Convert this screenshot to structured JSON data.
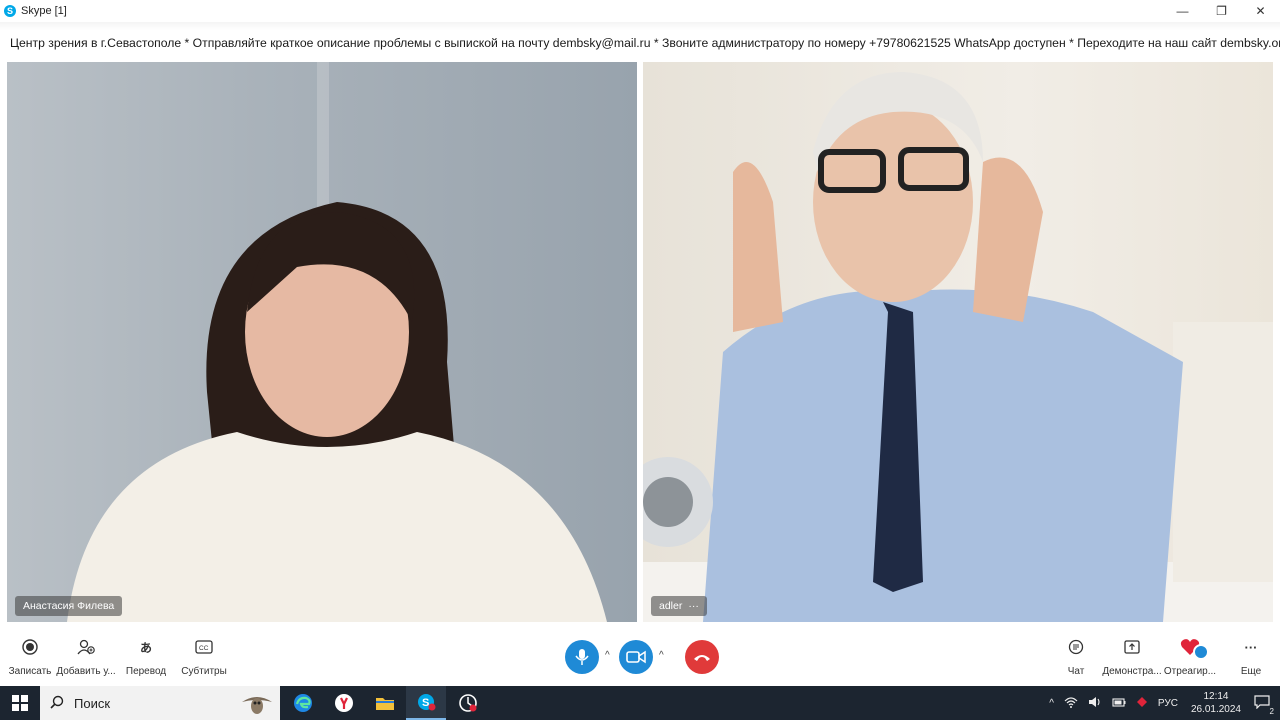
{
  "window": {
    "title": "Skype [1]",
    "minimize": "—",
    "restore": "❐",
    "close": "✕"
  },
  "ticker": {
    "text": "Центр зрения в г.Севастополе * Отправляйте краткое описание проблемы с выпиской на почту dembsky@mail.ru * Звоните администратору по номеру +79780621525 WhatsApp доступен * Переходите на наш сайт dembsky.org"
  },
  "participants": [
    {
      "name": "Анастасия Филева"
    },
    {
      "name": "adler",
      "more": "···"
    }
  ],
  "controls": {
    "record": "Записать",
    "add_user": "Добавить у...",
    "translate": "Перевод",
    "subtitles": "Субтитры",
    "chat": "Чат",
    "screen_share": "Демонстра...",
    "react": "Отреагир...",
    "more": "Еще"
  },
  "taskbar": {
    "search_placeholder": "Поиск",
    "language": "РУС",
    "time": "12:14",
    "date": "26.01.2024",
    "notification_count": "2"
  },
  "colors": {
    "accent": "#1f8ad6",
    "hangup": "#e03a3a",
    "react_heart": "#e0243a",
    "taskbar": "#1c2530"
  }
}
